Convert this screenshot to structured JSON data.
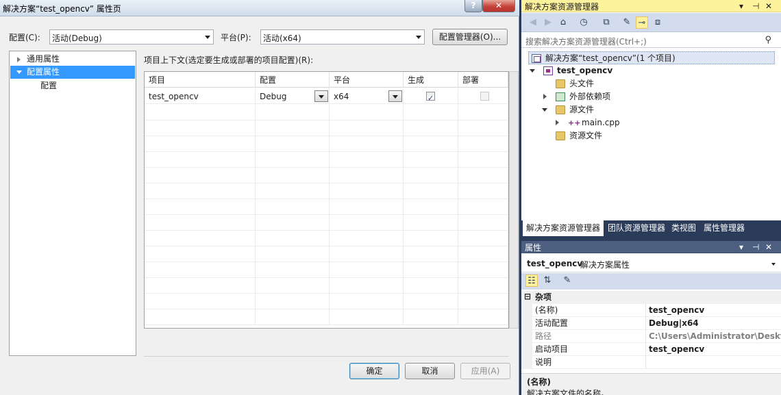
{
  "dialog": {
    "title": "解决方案“test_opencv” 属性页",
    "help_glyph": "?",
    "close_glyph": "✕",
    "config_label": "配置(C):",
    "config_value": "活动(Debug)",
    "platform_label": "平台(P):",
    "platform_value": "活动(x64)",
    "config_manager_button": "配置管理器(O)...",
    "tree": [
      {
        "label": "通用属性",
        "state": "collapsed"
      },
      {
        "label": "配置属性",
        "state": "expanded",
        "selected": true
      },
      {
        "label": "配置",
        "state": "leaf"
      }
    ],
    "grid_caption": "项目上下文(选定要生成或部署的项目配置)(R):",
    "grid_columns": [
      "项目",
      "配置",
      "平台",
      "生成",
      "部署"
    ],
    "grid_rows": [
      {
        "project": "test_opencv",
        "config": "Debug",
        "platform": "x64",
        "build": true,
        "deploy": false
      }
    ],
    "ok_button": "确定",
    "cancel_button": "取消",
    "apply_button": "应用(A)"
  },
  "solution_explorer": {
    "title": "解决方案资源管理器",
    "title_controls": [
      "▾",
      "⊣",
      "✕"
    ],
    "search_placeholder": "搜索解决方案资源管理器(Ctrl+;)",
    "search_icon": "search-icon",
    "toolbar_icons": [
      "back-icon",
      "forward-icon",
      "home-icon",
      "history-icon",
      "collapse-icon",
      "properties-wrench-icon",
      "pin-icon",
      "class-diagram-icon"
    ],
    "items": [
      {
        "label": "解决方案“test_opencv”(1 个项目)",
        "icon": "solution-icon",
        "level": 0,
        "selected": true
      },
      {
        "label": "test_opencv",
        "icon": "project-icon",
        "level": 1,
        "bold": true,
        "expand": "expanded"
      },
      {
        "label": "头文件",
        "icon": "folder-icon",
        "level": 2
      },
      {
        "label": "外部依赖项",
        "icon": "dependencies-icon",
        "level": 2,
        "expand": "collapsed"
      },
      {
        "label": "源文件",
        "icon": "folder-icon",
        "level": 2,
        "expand": "expanded"
      },
      {
        "label": "main.cpp",
        "icon": "cpp-file-icon",
        "level": 3,
        "expand": "collapsed"
      },
      {
        "label": "资源文件",
        "icon": "folder-icon",
        "level": 2
      }
    ],
    "tabs": [
      "解决方案资源管理器",
      "团队资源管理器",
      "类视图",
      "属性管理器"
    ]
  },
  "properties": {
    "title": "属性",
    "title_controls": [
      "▾",
      "⊣",
      "✕"
    ],
    "object_name": "test_opencv",
    "object_kind": "解决方案属性",
    "category": "杂项",
    "rows": [
      {
        "name": "(名称)",
        "value": "test_opencv",
        "gray": false
      },
      {
        "name": "活动配置",
        "value": "Debug|x64",
        "gray": false
      },
      {
        "name": "路径",
        "value": "C:\\Users\\Administrator\\Deskto",
        "gray": true
      },
      {
        "name": "启动项目",
        "value": "test_opencv",
        "gray": false
      },
      {
        "name": "说明",
        "value": "",
        "gray": false
      }
    ],
    "desc_title": "(名称)",
    "desc_text": "解决方案文件的名称。"
  },
  "colors": {
    "accent": "#3399ff",
    "tool_title_active": "#fff29d",
    "tool_title_inactive": "#4d6082",
    "ide_background": "#2b3c5a"
  }
}
